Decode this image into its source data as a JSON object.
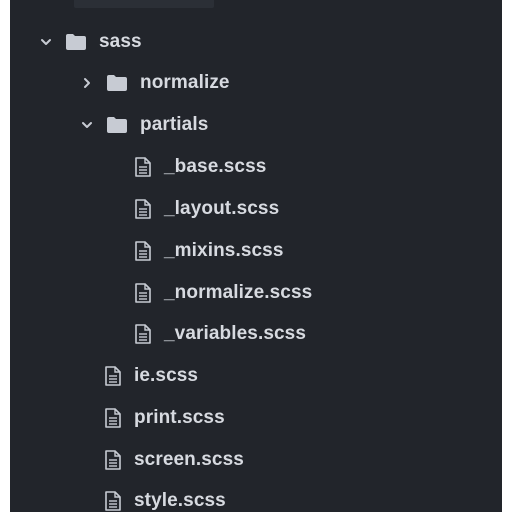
{
  "tree": {
    "sass_folder": {
      "label": "sass",
      "expanded": true
    },
    "normalize_folder": {
      "label": "normalize",
      "expanded": false
    },
    "partials_folder": {
      "label": "partials",
      "expanded": true
    },
    "partials_files": [
      {
        "label": "_base.scss"
      },
      {
        "label": "_layout.scss"
      },
      {
        "label": "_mixins.scss"
      },
      {
        "label": "_normalize.scss"
      },
      {
        "label": "_variables.scss"
      }
    ],
    "sass_files": [
      {
        "label": "ie.scss"
      },
      {
        "label": "print.scss"
      },
      {
        "label": "screen.scss"
      },
      {
        "label": "style.scss"
      }
    ]
  },
  "colors": {
    "background": "#22252b",
    "text": "#d7dae0",
    "icon": "#c7cbd3"
  }
}
